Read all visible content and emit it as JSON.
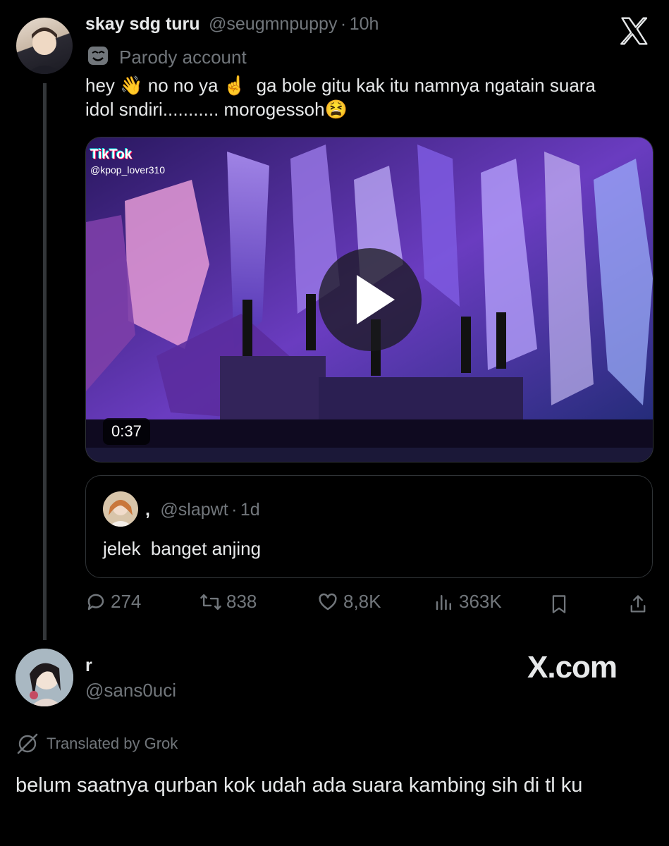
{
  "post": {
    "display_name": "skay sdg turu",
    "handle": "@seugmnpuppy",
    "separator": "·",
    "time": "10h",
    "badge_label": "Parody account",
    "text_line1_a": "hey",
    "text_line1_b": "no no ya",
    "text_line1_c": "ga bole gitu kak itu namnya ngatain suara",
    "text_line2_a": "idol sndiri........... morogessoh",
    "emoji_wave": "👋",
    "emoji_point": "☝️",
    "emoji_tired": "😫",
    "video": {
      "watermark_brand": "TikTok",
      "watermark_user": "@kpop_lover310",
      "duration": "0:37"
    },
    "quote": {
      "display_name": ",",
      "handle": "@slapwt",
      "separator": "·",
      "time": "1d",
      "text": "jelek  banget anjing"
    },
    "actions": {
      "replies": "274",
      "reposts": "838",
      "likes": "8,8K",
      "views": "363K"
    }
  },
  "reply": {
    "display_name": "r",
    "handle": "@sans0uci",
    "translated_label": "Translated by Grok",
    "text": "belum saatnya qurban kok udah ada suara kambing sih di tl ku"
  },
  "watermark": {
    "x_logo": "X",
    "x_com": "X.com"
  },
  "colors": {
    "background": "#000000",
    "text": "#e7e9ea",
    "muted": "#71767b",
    "border": "#2f3336"
  },
  "icons": [
    "x-logo-icon",
    "parody-mask-icon",
    "play-icon",
    "reply-icon",
    "repost-icon",
    "like-icon",
    "views-icon",
    "bookmark-icon",
    "share-icon",
    "grok-icon"
  ]
}
